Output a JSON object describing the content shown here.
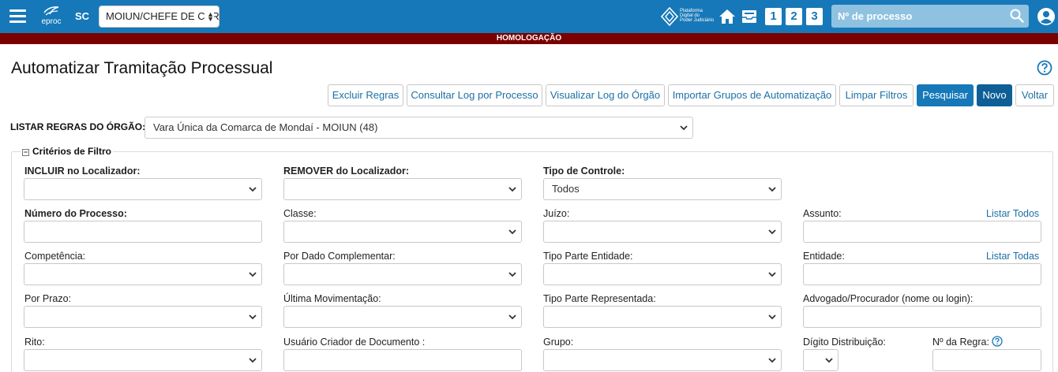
{
  "header": {
    "logo_text": "eproc",
    "state": "SC",
    "profile": "MOIUN/CHEFE DE CARTÓRIO",
    "platform_lines": [
      "Plataforma",
      "Digital do",
      "Poder Judiciário"
    ],
    "quick_buttons": [
      "1",
      "2",
      "3"
    ],
    "search_placeholder": "Nº de processo"
  },
  "environment_banner": "HOMOLOGAÇÃO",
  "page": {
    "title": "Automatizar Tramitação Processual"
  },
  "toolbar": {
    "excluir": "Excluir Regras",
    "consultar_log": "Consultar Log por Processo",
    "visualizar_log": "Visualizar Log do Órgão",
    "importar": "Importar Grupos de Automatização",
    "limpar": "Limpar Filtros",
    "pesquisar": "Pesquisar",
    "novo": "Novo",
    "voltar": "Voltar"
  },
  "orgao": {
    "label": "LISTAR REGRAS DO ÓRGÃO:",
    "value": "Vara Única da Comarca de Mondaí - MOIUN (48)"
  },
  "filters": {
    "legend": "Critérios de Filtro",
    "incluir_localizador": "INCLUIR no Localizador:",
    "remover_localizador": "REMOVER do Localizador:",
    "tipo_controle": "Tipo de Controle:",
    "tipo_controle_value": "Todos",
    "numero_processo": "Número do Processo:",
    "classe": "Classe:",
    "juizo": "Juízo:",
    "assunto": "Assunto:",
    "listar_todos": "Listar Todos",
    "competencia": "Competência:",
    "por_dado_complementar": "Por Dado Complementar:",
    "tipo_parte_entidade": "Tipo Parte Entidade:",
    "entidade": "Entidade:",
    "listar_todas": "Listar Todas",
    "por_prazo": "Por Prazo:",
    "ultima_movimentacao": "Última Movimentação:",
    "tipo_parte_representada": "Tipo Parte Representada:",
    "advogado": "Advogado/Procurador (nome ou login):",
    "rito": "Rito:",
    "usuario_criador": "Usuário Criador de Documento :",
    "grupo": "Grupo:",
    "digito_distribuicao": "Dígito Distribuição:",
    "numero_regra": "Nº da Regra:"
  },
  "colors": {
    "primary": "#1678b8",
    "banner": "#7b0000",
    "link": "#1d6fa5"
  }
}
